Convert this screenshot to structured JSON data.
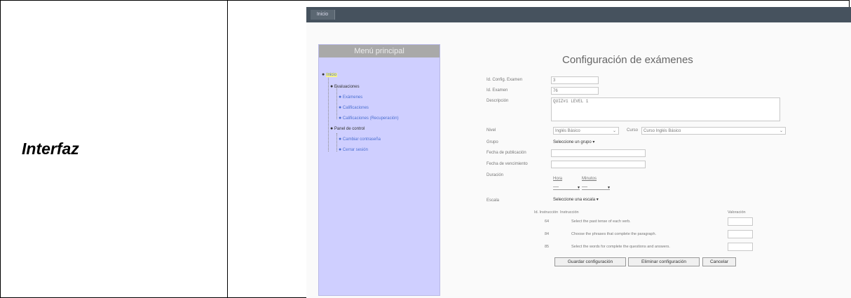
{
  "document": {
    "row_label": "Interfaz"
  },
  "app": {
    "topbar_tab": "Inicio"
  },
  "sidebar": {
    "title": "Menú principal",
    "root": "Inicio",
    "groups": [
      {
        "label": "Evaluaciones",
        "items": [
          "Exámenes",
          "Calificaciones",
          "Calificaciones (Recuperación)"
        ]
      },
      {
        "label": "Panel de control",
        "items": [
          "Cambiar contraseña",
          "Cerrar sesión"
        ]
      }
    ]
  },
  "form": {
    "title": "Configuración de exámenes",
    "labels": {
      "id_config": "Id. Config. Examen",
      "id_exam": "Id. Examen",
      "description": "Descripción",
      "level": "Nivel",
      "course": "Curso",
      "group": "Grupo",
      "pub_date": "Fecha de publicación",
      "due_date": "Fecha de vencimiento",
      "duration": "Duración",
      "hour": "Hora",
      "minutes": "Minutos",
      "scale": "Escala"
    },
    "values": {
      "id_config": "3",
      "id_exam": "76",
      "description": "QUIZ#1 LEVEL 1",
      "level": "Inglés Básico",
      "course": "Curso Inglés Básico",
      "group": "Seleccione un grupo",
      "pub_date": "",
      "due_date": "",
      "hour": "----",
      "minutes": "----",
      "scale": "Seleccione una escala"
    }
  },
  "instructions": {
    "headers": [
      "Id. Instrucción",
      "Instrucción",
      "Valoración"
    ],
    "rows": [
      {
        "id": "64",
        "text": "Select the past tense of each verb.",
        "value": ""
      },
      {
        "id": "84",
        "text": "Choose the phrases that complete the paragraph.",
        "value": ""
      },
      {
        "id": "85",
        "text": "Select the words for complete the questions and answers.",
        "value": ""
      }
    ]
  },
  "buttons": {
    "save": "Guardar configuración",
    "delete": "Eliminar configuración",
    "cancel": "Cancelar"
  }
}
